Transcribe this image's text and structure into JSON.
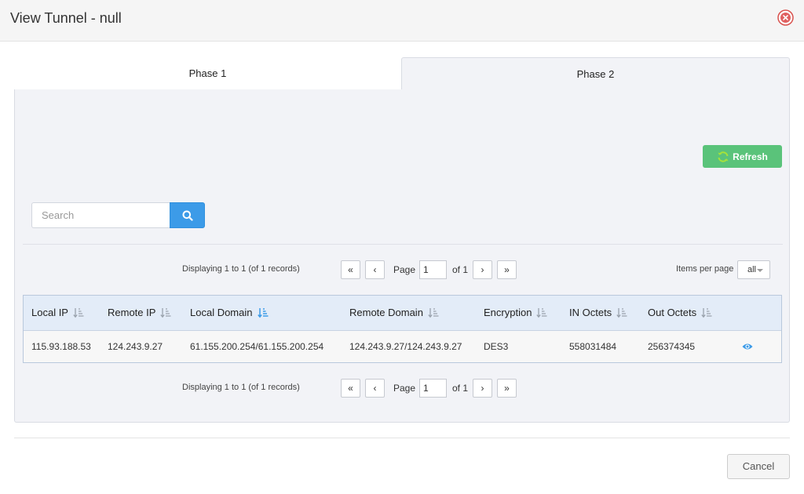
{
  "dialog": {
    "title": "View Tunnel - null"
  },
  "tabs": [
    {
      "label": "Phase 1",
      "active": false
    },
    {
      "label": "Phase 2",
      "active": true
    }
  ],
  "toolbar": {
    "refresh_label": "Refresh",
    "refresh_icon": "refresh-icon",
    "refresh_color": "#5ac37a"
  },
  "search": {
    "placeholder": "Search",
    "value": "",
    "button_icon": "search-icon",
    "button_color": "#3c9be8"
  },
  "pager_top": {
    "display_text": "Displaying 1 to 1 (of 1 records)",
    "first": "«",
    "prev": "‹",
    "page_label": "Page",
    "page_value": "1",
    "of_label": "of 1",
    "next": "›",
    "last": "»",
    "items_per_page_label": "Items per page",
    "items_per_page_value": "all"
  },
  "pager_bottom": {
    "display_text": "Displaying 1 to 1 (of 1 records)",
    "first": "«",
    "prev": "‹",
    "page_label": "Page",
    "page_value": "1",
    "of_label": "of 1",
    "next": "›",
    "last": "»"
  },
  "table": {
    "columns": [
      "Local IP",
      "Remote IP",
      "Local Domain",
      "Remote Domain",
      "Encryption",
      "IN Octets",
      "Out Octets"
    ],
    "active_sort_column": "Local Domain",
    "rows": [
      {
        "local_ip": "115.93.188.53",
        "remote_ip": "124.243.9.27",
        "local_domain": "61.155.200.254/61.155.200.254",
        "remote_domain": "124.243.9.27/124.243.9.27",
        "encryption": "DES3",
        "in_octets": "558031484",
        "out_octets": "256374345",
        "action_icon": "eye-icon"
      }
    ]
  },
  "footer": {
    "cancel_label": "Cancel"
  }
}
